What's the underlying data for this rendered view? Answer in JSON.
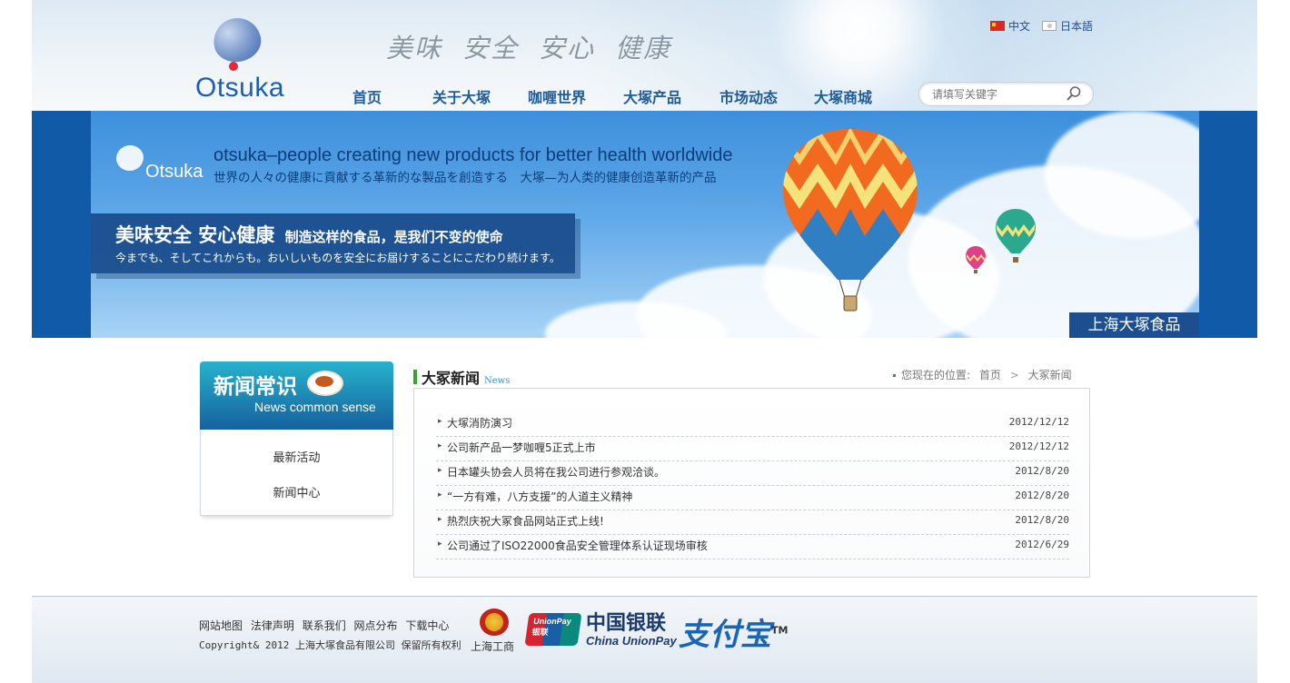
{
  "header": {
    "logo_text": "Otsuka",
    "slogan": [
      "美味",
      "安全",
      "安心",
      "健康"
    ],
    "lang_cn": "中文",
    "lang_jp": "日本語",
    "nav": [
      "首页",
      "关于大塚",
      "咖喱世界",
      "大塚产品",
      "市场动态",
      "大塚商城"
    ],
    "search_placeholder": "请填写关键字"
  },
  "banner": {
    "logo_text": "Otsuka",
    "en_tagline": "otsuka–people creating new products for better health worldwide",
    "jp_line": "世界の人々の健康に貢献する革新的な製品を創造する　大塚—为人类的健康创造革新的产品",
    "box_title": "美味安全 安心健康",
    "box_subtitle": "制造这样的食品，是我们不变的使命",
    "box_jp": "今までも、そしてこれからも。おいしいものを安全にお届けすることにこだわり続けます。",
    "label": "上海大塚食品"
  },
  "sidebar": {
    "title_cn": "新闻常识",
    "title_en": "News common sense",
    "items": [
      "最新活动",
      "新闻中心"
    ]
  },
  "news": {
    "title_cn": "大冢新闻",
    "title_en": "News",
    "breadcrumb_prefix": "您现在的位置:",
    "breadcrumb_home": "首页",
    "breadcrumb_sep": ">",
    "breadcrumb_current": "大冢新闻",
    "items": [
      {
        "title": "大塚消防演习",
        "date": "2012/12/12"
      },
      {
        "title": "公司新产品一梦咖喱5正式上市",
        "date": "2012/12/12"
      },
      {
        "title": "日本罐头协会人员将在我公司进行参观洽谈。",
        "date": "2012/8/20"
      },
      {
        "title": "“一方有难，八方支援”的人道主义精神",
        "date": "2012/8/20"
      },
      {
        "title": "热烈庆祝大冢食品网站正式上线!",
        "date": "2012/8/20"
      },
      {
        "title": "公司通过了ISO22000食品安全管理体系认证现场审核",
        "date": "2012/6/29"
      }
    ]
  },
  "footer": {
    "links": [
      "网站地图",
      "法律声明",
      "联系我们",
      "网点分布",
      "下载中心"
    ],
    "copyright": "Copyright& 2012 上海大塚食品有限公司 保留所有权利",
    "emblem_label": "上海工商",
    "unionpay_card": "UnionPay 银联",
    "unionpay_cn": "中国银联",
    "unionpay_en": "China UnionPay",
    "alipay": "支付宝",
    "alipay_tm": "TM"
  }
}
